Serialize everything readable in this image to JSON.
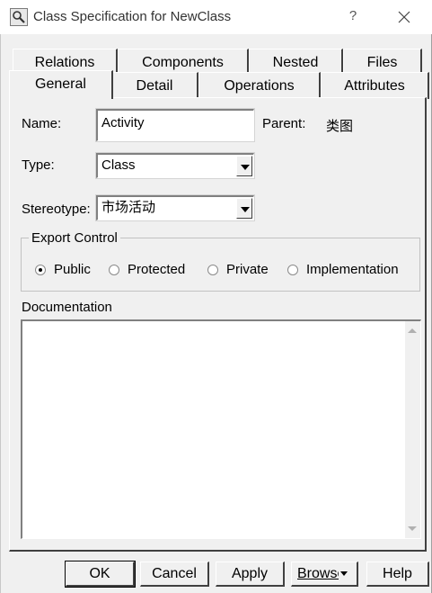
{
  "window": {
    "title": "Class Specification for NewClass",
    "help_glyph": "?"
  },
  "tabs": {
    "row_back": [
      "Relations",
      "Components",
      "Nested",
      "Files"
    ],
    "row_front": [
      "General",
      "Detail",
      "Operations",
      "Attributes"
    ],
    "active": "General"
  },
  "general": {
    "name_label": "Name:",
    "name_value": "Activity",
    "parent_label": "Parent:",
    "parent_value": "类图",
    "type_label": "Type:",
    "type_value": "Class",
    "stereotype_label": "Stereotype:",
    "stereotype_value": "市场活动",
    "export_control": {
      "legend": "Export Control",
      "options": [
        "Public",
        "Protected",
        "Private",
        "Implementation"
      ],
      "selected": "Public"
    },
    "documentation_label": "Documentation",
    "documentation_value": ""
  },
  "buttons": {
    "ok": "OK",
    "cancel": "Cancel",
    "apply": "Apply",
    "browse": "Browse",
    "help": "Help"
  },
  "icons": {
    "app": "magnifier-icon",
    "close": "close-icon"
  }
}
